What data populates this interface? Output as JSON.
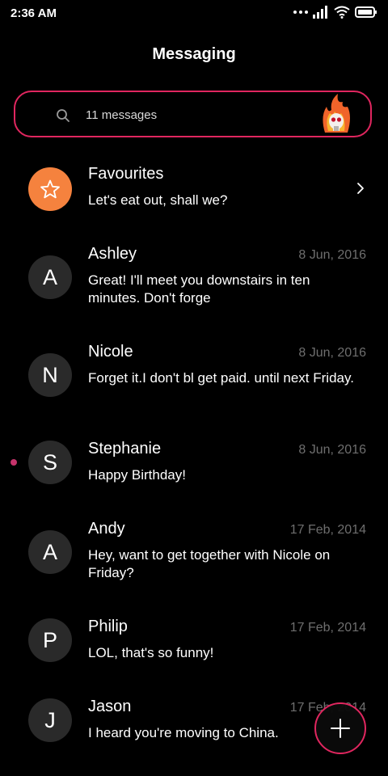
{
  "status_bar": {
    "time": "2:36 AM",
    "icons": [
      "more-dots-icon",
      "signal-icon",
      "wifi-icon",
      "battery-icon"
    ]
  },
  "app": {
    "title": "Messaging"
  },
  "search": {
    "text": "11 messages",
    "icon": "search-icon",
    "avatar_icon": "flaming-skull-avatar-icon"
  },
  "favourites": {
    "name": "Favourites",
    "message": "Let's eat out, shall we?",
    "icon": "star-icon"
  },
  "conversations": [
    {
      "initial": "A",
      "name": "Ashley",
      "date": "8 Jun, 2016",
      "message": "Great! I'll meet you downstairs in ten minutes. Don't forge",
      "unread": false
    },
    {
      "initial": "N",
      "name": "Nicole",
      "date": "8 Jun, 2016",
      "message": "Forget it.I don't bl get paid. until next Friday.",
      "unread": false
    },
    {
      "initial": "S",
      "name": "Stephanie",
      "date": "8 Jun, 2016",
      "message": "Happy Birthday!",
      "unread": true
    },
    {
      "initial": "A",
      "name": "Andy",
      "date": "17 Feb, 2014",
      "message": "Hey, want to get together with Nicole on Friday?",
      "unread": false
    },
    {
      "initial": "P",
      "name": "Philip",
      "date": "17 Feb, 2014",
      "message": "LOL, that's so funny!",
      "unread": false
    },
    {
      "initial": "J",
      "name": "Jason",
      "date": "17 Feb, 2014",
      "message": "I heard you're moving to China.",
      "unread": false
    }
  ],
  "fab": {
    "icon": "plus-icon"
  },
  "colors": {
    "background": "#000000",
    "accent": "#e0265f",
    "favourite_avatar": "#f5823e",
    "unread_dot": "#c6336b",
    "date_text": "#6e6e6e",
    "avatar_bg": "#2a2a2a"
  }
}
